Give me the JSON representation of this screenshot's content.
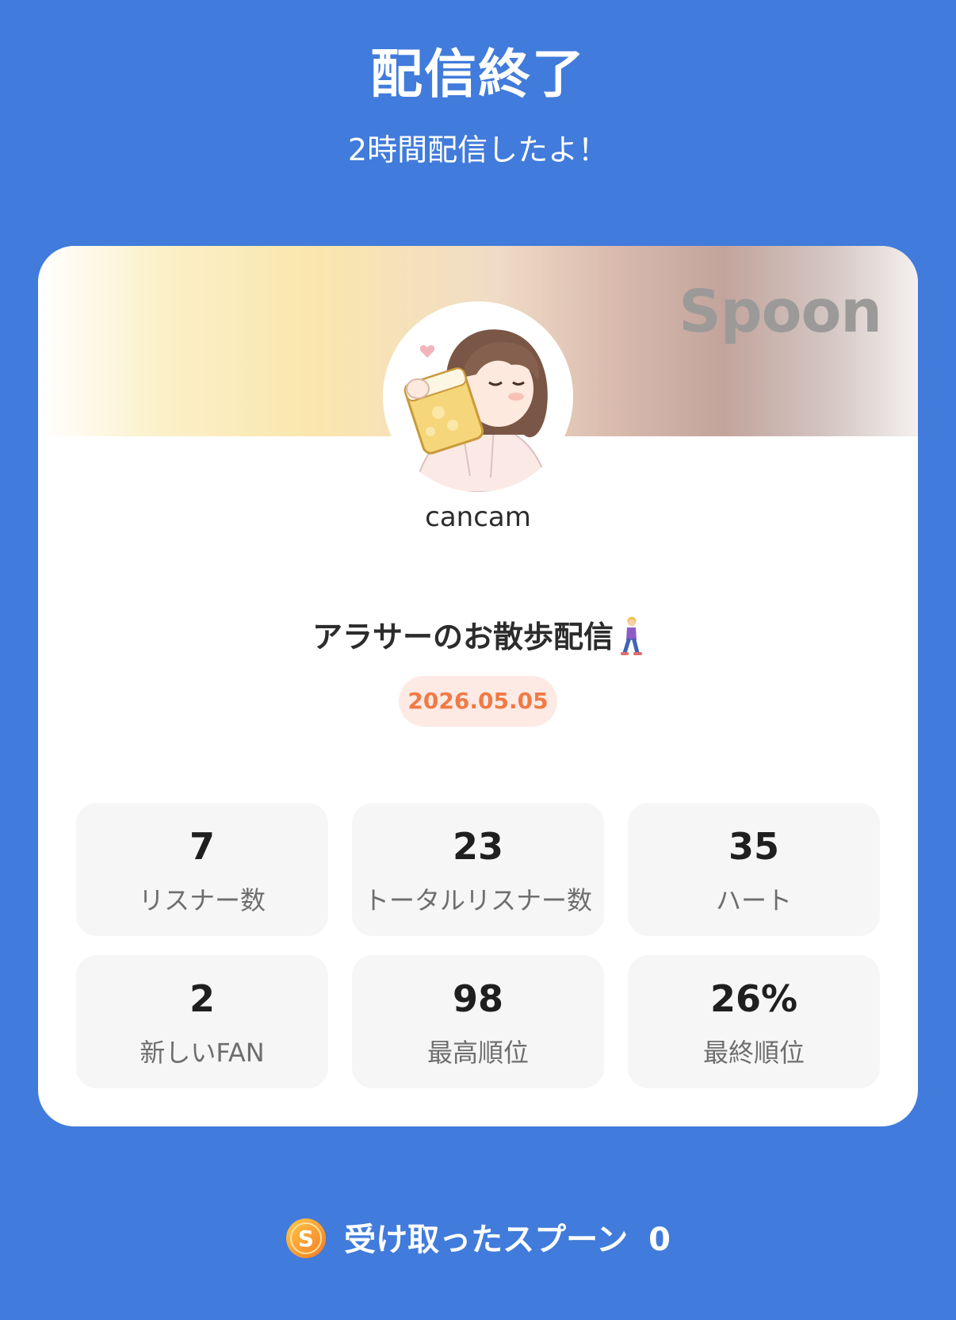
{
  "header": {
    "title": "配信終了",
    "subtitle": "2時間配信したよ！"
  },
  "card": {
    "brand_logo": "Spoon",
    "avatar_icon": "avatar-girl-drinking-beer-icon",
    "username": "cancam",
    "broadcast_title": "アラサーのお散歩配信",
    "title_icon": "woman-walking-icon",
    "date": "2026.05.05",
    "stats": [
      {
        "value": "7",
        "label": "リスナー数"
      },
      {
        "value": "23",
        "label": "トータルリスナー数"
      },
      {
        "value": "35",
        "label": "ハート"
      },
      {
        "value": "2",
        "label": "新しいFAN"
      },
      {
        "value": "98",
        "label": "最高順位"
      },
      {
        "value": "26%",
        "label": "最終順位"
      }
    ]
  },
  "footer": {
    "icon": "spoon-coin-icon",
    "label": "受け取ったスプーン",
    "count": "0"
  },
  "colors": {
    "background": "#417BDB",
    "card": "#FFFFFF",
    "date_text": "#F07A45",
    "date_badge": "#FDEAE4",
    "stat_tile": "#F6F6F6"
  }
}
